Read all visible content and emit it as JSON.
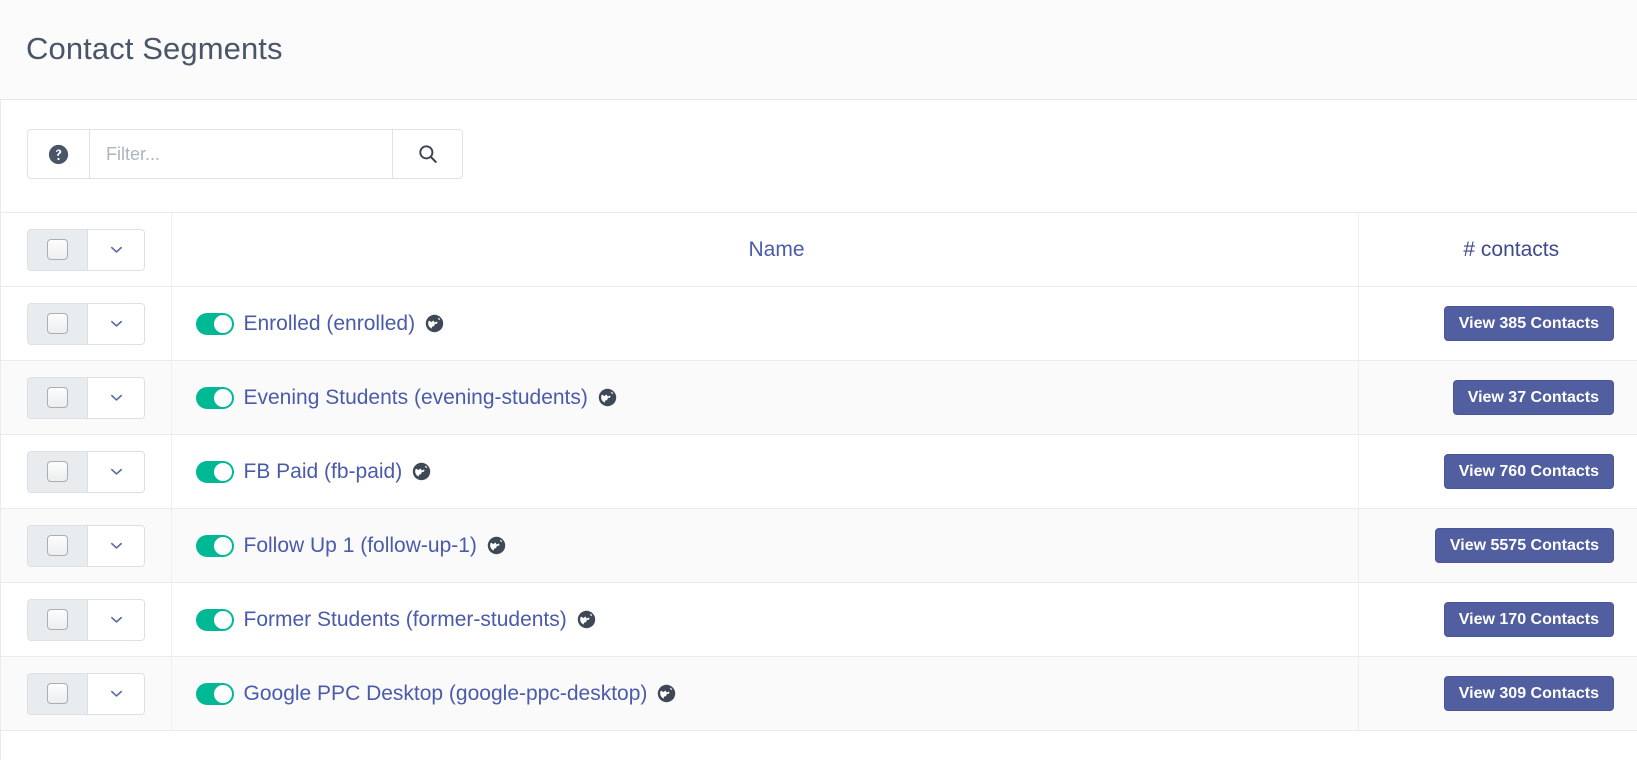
{
  "header": {
    "title": "Contact Segments"
  },
  "toolbar": {
    "help_icon": "question-circle-icon",
    "filter_placeholder": "Filter...",
    "filter_value": "",
    "search_icon": "search-icon"
  },
  "table": {
    "columns": {
      "select": "",
      "name": "Name",
      "contacts": "# contacts"
    },
    "rows": [
      {
        "name": "Enrolled (enrolled)",
        "published": true,
        "globe_icon": "globe-icon",
        "action_label": "View 385 Contacts",
        "contacts": 385
      },
      {
        "name": "Evening Students (evening-students)",
        "published": true,
        "globe_icon": "globe-icon",
        "action_label": "View 37 Contacts",
        "contacts": 37
      },
      {
        "name": "FB Paid (fb-paid)",
        "published": true,
        "globe_icon": "globe-icon",
        "action_label": "View 760 Contacts",
        "contacts": 760
      },
      {
        "name": "Follow Up 1 (follow-up-1)",
        "published": true,
        "globe_icon": "globe-icon",
        "action_label": "View 5575 Contacts",
        "contacts": 5575
      },
      {
        "name": "Former Students (former-students)",
        "published": true,
        "globe_icon": "globe-icon",
        "action_label": "View 170 Contacts",
        "contacts": 170
      },
      {
        "name": "Google PPC Desktop (google-ppc-desktop)",
        "published": true,
        "globe_icon": "globe-icon",
        "action_label": "View 309 Contacts",
        "contacts": 309
      }
    ]
  },
  "colors": {
    "accent_link": "#4a5bab",
    "button_primary": "#515ea0",
    "toggle_on": "#00b894",
    "header_bg": "#fbfbfc",
    "row_alt_bg": "#fafafb",
    "border": "#e9ecef"
  }
}
